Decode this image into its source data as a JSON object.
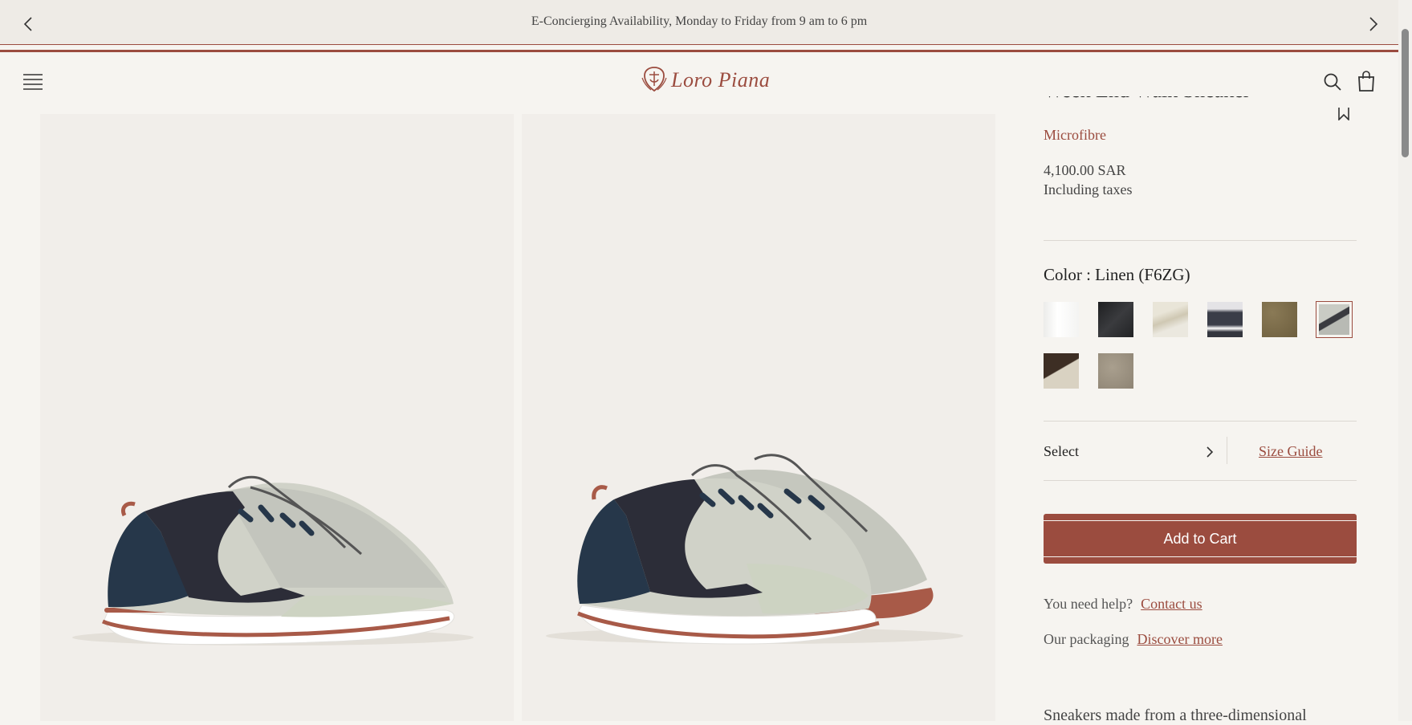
{
  "announcement": {
    "text": "E-Concierging Availability, Monday to Friday from 9 am to 6 pm",
    "prev_icon": "chevron-left-icon",
    "next_icon": "chevron-right-icon"
  },
  "header": {
    "logo_text": "Loro Piana",
    "menu_icon": "hamburger-menu-icon",
    "search_icon": "search-icon",
    "bag_icon": "shopping-bag-icon"
  },
  "product": {
    "name": "Week End Walk Sneaker",
    "material": "Microfibre",
    "price": "4,100.00 SAR",
    "tax_note": "Including taxes",
    "color_label": "Color : Linen (F6ZG)",
    "swatches": [
      {
        "name": "white",
        "color": "#f8f8f6"
      },
      {
        "name": "black",
        "color": "#2a2b2d"
      },
      {
        "name": "beige-white",
        "color": "#d8d3c4"
      },
      {
        "name": "navy-white",
        "color": "#3a3d48"
      },
      {
        "name": "olive-brown",
        "color": "#7a6a48"
      },
      {
        "name": "linen",
        "color": "#b8bab4",
        "selected": true
      },
      {
        "name": "brown-beige",
        "color": "#4a3a30"
      },
      {
        "name": "taupe",
        "color": "#9e9484"
      }
    ],
    "size_select_label": "Select",
    "size_guide_label": "Size Guide",
    "add_to_cart_label": "Add to Cart",
    "help_text": "You need help?",
    "help_link": "Contact us",
    "packaging_text": "Our packaging",
    "packaging_link": "Discover more",
    "description_start": "Sneakers made from a three-dimensional",
    "wishlist_icon": "bookmark-icon"
  },
  "colors": {
    "brand": "#9b4c3f",
    "background": "#f6f4f0"
  }
}
